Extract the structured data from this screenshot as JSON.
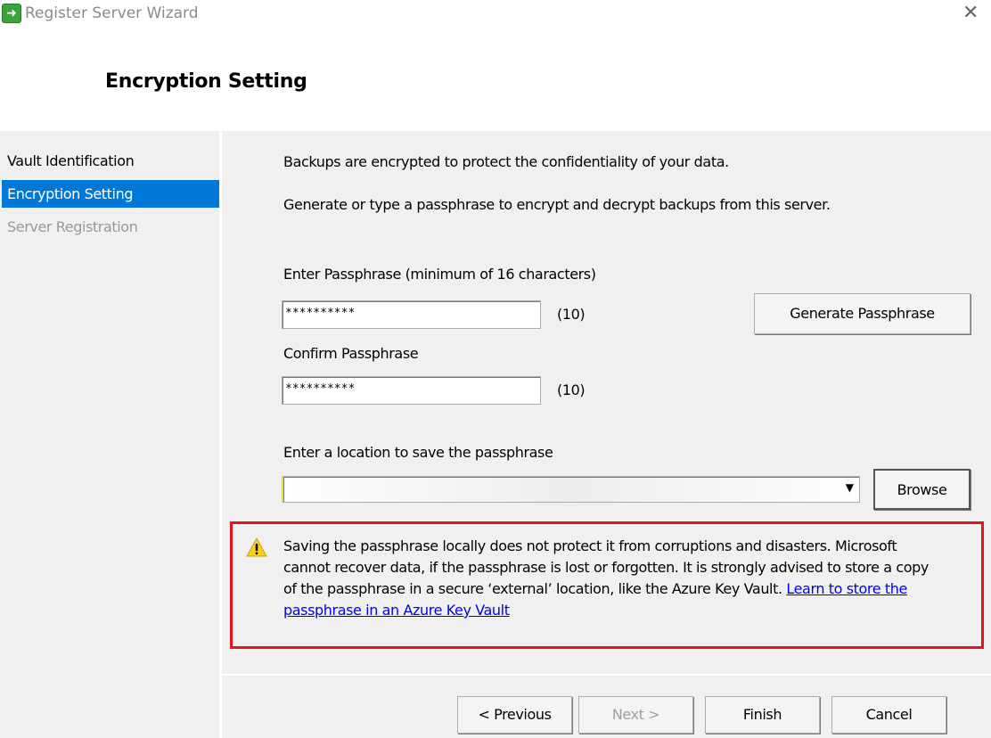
{
  "window": {
    "title": "Register Server Wizard",
    "close_icon": "close-icon"
  },
  "page_title": "Encryption Setting",
  "sidebar": {
    "items": [
      {
        "label": "Vault Identification",
        "state": "done"
      },
      {
        "label": "Encryption Setting",
        "state": "active"
      },
      {
        "label": "Server Registration",
        "state": "disabled"
      }
    ],
    "active_color": "#0078d7"
  },
  "main": {
    "intro1": "Backups are encrypted to protect the confidentiality of your data.",
    "intro2": "Generate or type a passphrase to encrypt and decrypt backups from this server.",
    "passphrase_label": "Enter Passphrase (minimum of 16 characters)",
    "passphrase_value": "**********",
    "passphrase_count": "(10)",
    "generate_button": "Generate Passphrase",
    "confirm_label": "Confirm Passphrase",
    "confirm_value": "**********",
    "confirm_count": "(10)",
    "location_label": "Enter a location to save the passphrase",
    "location_value": "",
    "browse_button": "Browse",
    "warning": {
      "icon": "warning-icon",
      "text": "Saving the passphrase locally does not protect it from corruptions and disasters. Microsoft cannot recover data, if the passphrase is lost or forgotten. It is strongly advised to store a copy of the passphrase in a secure ‘external’ location, like the Azure Key Vault. ",
      "link": "Learn to store the passphrase in an Azure Key Vault",
      "highlight_color": "#e3131f"
    }
  },
  "footer": {
    "previous": "< Previous",
    "next": "Next >",
    "finish": "Finish",
    "cancel": "Cancel"
  }
}
